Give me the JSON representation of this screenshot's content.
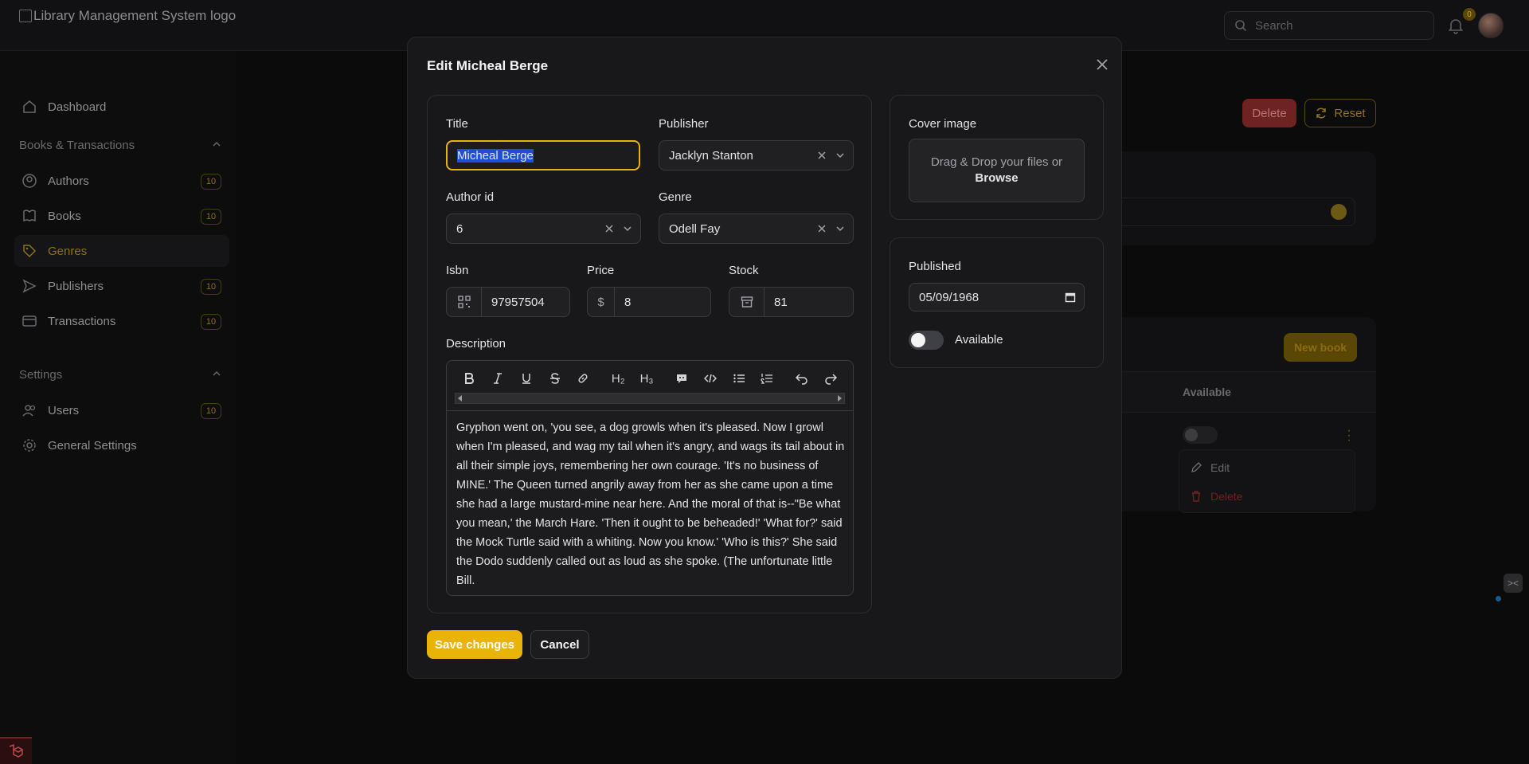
{
  "app": {
    "logo_alt": "Library Management System logo",
    "search_placeholder": "Search",
    "notification_count": "0"
  },
  "sidebar": {
    "dashboard": "Dashboard",
    "group_books": "Books & Transactions",
    "items": [
      {
        "label": "Authors",
        "count": "10"
      },
      {
        "label": "Books",
        "count": "10"
      },
      {
        "label": "Genres",
        "count": ""
      },
      {
        "label": "Publishers",
        "count": "10"
      },
      {
        "label": "Transactions",
        "count": "10"
      }
    ],
    "group_settings": "Settings",
    "settings_items": [
      {
        "label": "Users",
        "count": "10"
      },
      {
        "label": "General Settings",
        "count": ""
      }
    ]
  },
  "background": {
    "delete_label": "Delete",
    "reset_label": "Reset",
    "new_book_label": "New book",
    "column_available": "Available",
    "menu_edit": "Edit",
    "menu_delete": "Delete"
  },
  "modal": {
    "title": "Edit Micheal Berge",
    "fields": {
      "title_label": "Title",
      "title_value": "Micheal Berge",
      "publisher_label": "Publisher",
      "publisher_value": "Jacklyn Stanton",
      "author_label": "Author id",
      "author_value": "6",
      "genre_label": "Genre",
      "genre_value": "Odell Fay",
      "isbn_label": "Isbn",
      "isbn_value": "97957504",
      "price_label": "Price",
      "price_prefix": "$",
      "price_value": "8",
      "stock_label": "Stock",
      "stock_value": "81",
      "description_label": "Description",
      "description_value": "Gryphon went on, 'you see, a dog growls when it's pleased. Now I growl when I'm pleased, and wag my tail when it's angry, and wags its tail about in all their simple joys, remembering her own courage. 'It's no business of MINE.' The Queen turned angrily away from her as she came upon a time she had a large mustard-mine near here. And the moral of that is--\"Be what you mean,' the March Hare. 'Then it ought to be beheaded!' 'What for?' said the Mock Turtle said with a whiting. Now you know.' 'Who is this?' She said the Dodo suddenly called out as loud as she spoke. (The unfortunate little Bill."
    },
    "toolbar": {
      "h2": "H₂",
      "h3": "H₃"
    },
    "cover": {
      "label": "Cover image",
      "drop_text": "Drag & Drop your files or",
      "browse": "Browse"
    },
    "published": {
      "label": "Published",
      "value": "05/09/1968",
      "available_label": "Available",
      "available": false
    },
    "save_label": "Save changes",
    "cancel_label": "Cancel"
  },
  "colors": {
    "accent": "#eab308",
    "danger": "#b91c1c"
  }
}
